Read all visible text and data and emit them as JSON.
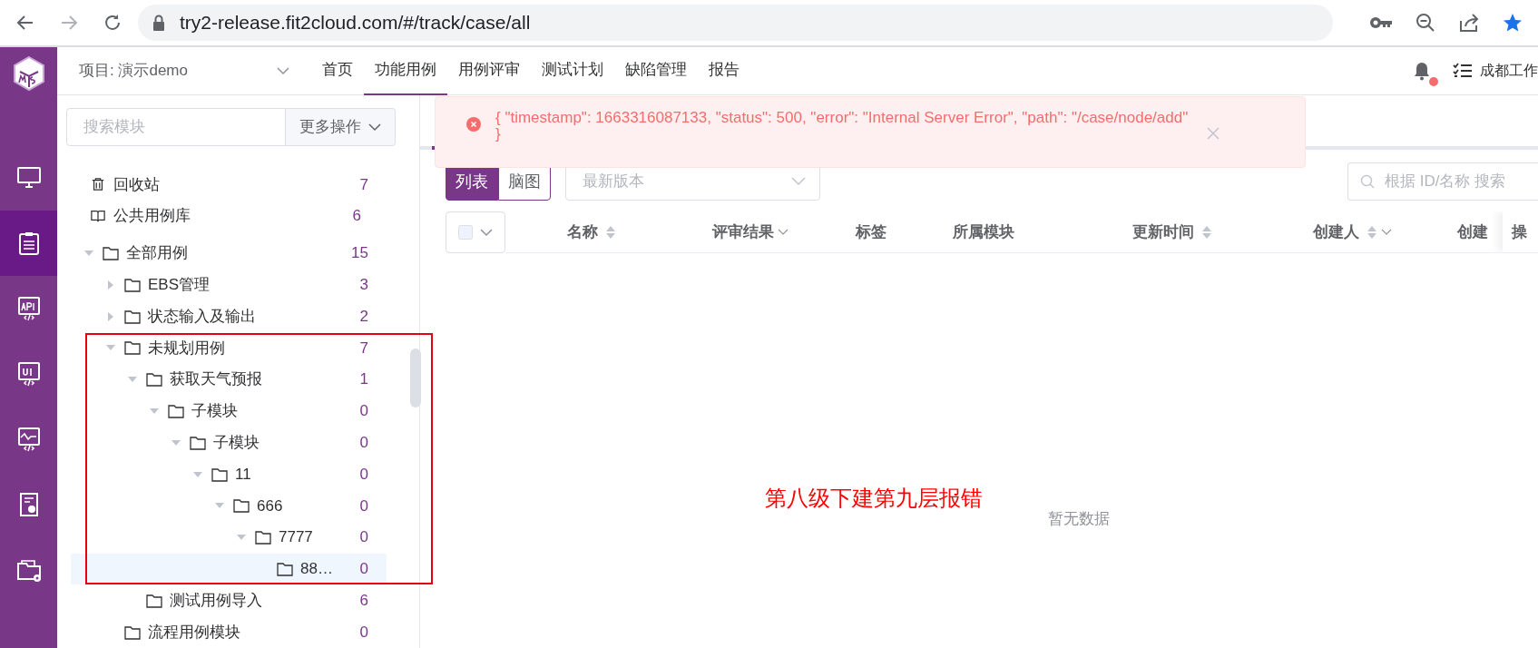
{
  "browser": {
    "url": "try2-release.fit2cloud.com/#/track/case/all"
  },
  "sidebar": {
    "items": [
      {
        "selected": false
      },
      {
        "selected": true
      },
      {
        "selected": false
      },
      {
        "selected": false
      },
      {
        "selected": false
      },
      {
        "selected": false
      },
      {
        "selected": false
      }
    ]
  },
  "header": {
    "project": "项目: 演示demo",
    "nav": [
      {
        "label": "首页",
        "selected": false
      },
      {
        "label": "功能用例",
        "selected": true
      },
      {
        "label": "用例评审",
        "selected": false
      },
      {
        "label": "测试计划",
        "selected": false
      },
      {
        "label": "缺陷管理",
        "selected": false
      },
      {
        "label": "报告",
        "selected": false
      }
    ],
    "user": "成都工作"
  },
  "toast": {
    "kind": "error",
    "lines": [
      "{ \"timestamp\": 1663316087133, \"status\": 500, \"error\": \"Internal Server Error\", \"path\": \"/case/node/add\"",
      "}"
    ]
  },
  "module_panel": {
    "search_placeholder": "搜索模块",
    "more_button": "更多操作",
    "special": [
      {
        "kind": "trash",
        "label": "回收站",
        "count": "7"
      },
      {
        "kind": "library",
        "label": "公共用例库",
        "count": "6"
      }
    ],
    "tree": [
      {
        "label": "全部用例",
        "count": "15",
        "expanded": true,
        "selected": false,
        "children": [
          {
            "label": "EBS管理",
            "count": "3",
            "expanded": false,
            "selected": false
          },
          {
            "label": "状态输入及输出",
            "count": "2",
            "expanded": false,
            "selected": false
          },
          {
            "label": "未规划用例",
            "count": "7",
            "expanded": true,
            "selected": false,
            "children": [
              {
                "label": "获取天气预报",
                "count": "1",
                "expanded": true,
                "selected": false,
                "children": [
                  {
                    "label": "子模块",
                    "count": "0",
                    "expanded": true,
                    "selected": false,
                    "children": [
                      {
                        "label": "子模块",
                        "count": "0",
                        "expanded": true,
                        "selected": false,
                        "children": [
                          {
                            "label": "11",
                            "count": "0",
                            "expanded": true,
                            "selected": false,
                            "children": [
                              {
                                "label": "666",
                                "count": "0",
                                "expanded": true,
                                "selected": false,
                                "children": [
                                  {
                                    "label": "7777",
                                    "count": "0",
                                    "expanded": true,
                                    "selected": false,
                                    "children": [
                                      {
                                        "label": "88…",
                                        "count": "0",
                                        "selected": true
                                      }
                                    ]
                                  }
                                ]
                              }
                            ]
                          }
                        ]
                      }
                    ]
                  }
                ]
              },
              {
                "label": "测试用例导入",
                "count": "6",
                "selected": false
              }
            ]
          },
          {
            "label": "流程用例模块",
            "count": "0",
            "selected": false
          }
        ]
      }
    ]
  },
  "toolbar": {
    "views": [
      {
        "label": "列表",
        "selected": true
      },
      {
        "label": "脑图",
        "selected": false
      }
    ],
    "version_placeholder": "最新版本",
    "search_placeholder": "根据 ID/名称 搜索"
  },
  "table": {
    "columns": [
      {
        "label": "名称",
        "sortable": true,
        "filter": false
      },
      {
        "label": "评审结果",
        "sortable": false,
        "filter": true
      },
      {
        "label": "标签",
        "sortable": false,
        "filter": false
      },
      {
        "label": "所属模块",
        "sortable": false,
        "filter": false
      },
      {
        "label": "更新时间",
        "sortable": true,
        "filter": false
      },
      {
        "label": "创建人",
        "sortable": true,
        "filter": true
      },
      {
        "label": "创建",
        "sortable": false,
        "filter": false
      },
      {
        "label": "操",
        "sortable": false,
        "filter": false
      }
    ],
    "empty_text": "暂无数据"
  },
  "annotation": {
    "text": "第八级下建第九层报错"
  }
}
